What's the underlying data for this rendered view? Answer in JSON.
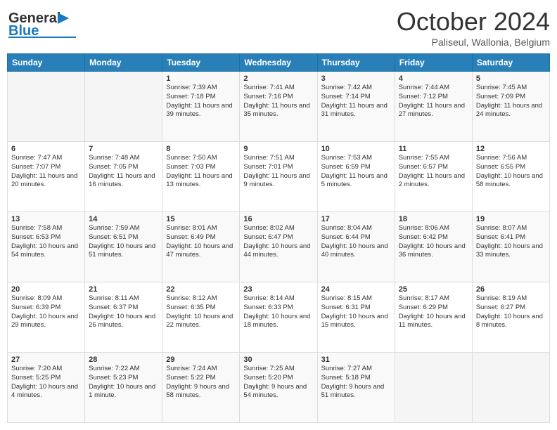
{
  "header": {
    "logo_line1": "General",
    "logo_line2": "Blue",
    "month": "October 2024",
    "location": "Paliseul, Wallonia, Belgium"
  },
  "days_of_week": [
    "Sunday",
    "Monday",
    "Tuesday",
    "Wednesday",
    "Thursday",
    "Friday",
    "Saturday"
  ],
  "weeks": [
    [
      {
        "day": "",
        "sunrise": "",
        "sunset": "",
        "daylight": ""
      },
      {
        "day": "",
        "sunrise": "",
        "sunset": "",
        "daylight": ""
      },
      {
        "day": "1",
        "sunrise": "Sunrise: 7:39 AM",
        "sunset": "Sunset: 7:18 PM",
        "daylight": "Daylight: 11 hours and 39 minutes."
      },
      {
        "day": "2",
        "sunrise": "Sunrise: 7:41 AM",
        "sunset": "Sunset: 7:16 PM",
        "daylight": "Daylight: 11 hours and 35 minutes."
      },
      {
        "day": "3",
        "sunrise": "Sunrise: 7:42 AM",
        "sunset": "Sunset: 7:14 PM",
        "daylight": "Daylight: 11 hours and 31 minutes."
      },
      {
        "day": "4",
        "sunrise": "Sunrise: 7:44 AM",
        "sunset": "Sunset: 7:12 PM",
        "daylight": "Daylight: 11 hours and 27 minutes."
      },
      {
        "day": "5",
        "sunrise": "Sunrise: 7:45 AM",
        "sunset": "Sunset: 7:09 PM",
        "daylight": "Daylight: 11 hours and 24 minutes."
      }
    ],
    [
      {
        "day": "6",
        "sunrise": "Sunrise: 7:47 AM",
        "sunset": "Sunset: 7:07 PM",
        "daylight": "Daylight: 11 hours and 20 minutes."
      },
      {
        "day": "7",
        "sunrise": "Sunrise: 7:48 AM",
        "sunset": "Sunset: 7:05 PM",
        "daylight": "Daylight: 11 hours and 16 minutes."
      },
      {
        "day": "8",
        "sunrise": "Sunrise: 7:50 AM",
        "sunset": "Sunset: 7:03 PM",
        "daylight": "Daylight: 11 hours and 13 minutes."
      },
      {
        "day": "9",
        "sunrise": "Sunrise: 7:51 AM",
        "sunset": "Sunset: 7:01 PM",
        "daylight": "Daylight: 11 hours and 9 minutes."
      },
      {
        "day": "10",
        "sunrise": "Sunrise: 7:53 AM",
        "sunset": "Sunset: 6:59 PM",
        "daylight": "Daylight: 11 hours and 5 minutes."
      },
      {
        "day": "11",
        "sunrise": "Sunrise: 7:55 AM",
        "sunset": "Sunset: 6:57 PM",
        "daylight": "Daylight: 11 hours and 2 minutes."
      },
      {
        "day": "12",
        "sunrise": "Sunrise: 7:56 AM",
        "sunset": "Sunset: 6:55 PM",
        "daylight": "Daylight: 10 hours and 58 minutes."
      }
    ],
    [
      {
        "day": "13",
        "sunrise": "Sunrise: 7:58 AM",
        "sunset": "Sunset: 6:53 PM",
        "daylight": "Daylight: 10 hours and 54 minutes."
      },
      {
        "day": "14",
        "sunrise": "Sunrise: 7:59 AM",
        "sunset": "Sunset: 6:51 PM",
        "daylight": "Daylight: 10 hours and 51 minutes."
      },
      {
        "day": "15",
        "sunrise": "Sunrise: 8:01 AM",
        "sunset": "Sunset: 6:49 PM",
        "daylight": "Daylight: 10 hours and 47 minutes."
      },
      {
        "day": "16",
        "sunrise": "Sunrise: 8:02 AM",
        "sunset": "Sunset: 6:47 PM",
        "daylight": "Daylight: 10 hours and 44 minutes."
      },
      {
        "day": "17",
        "sunrise": "Sunrise: 8:04 AM",
        "sunset": "Sunset: 6:44 PM",
        "daylight": "Daylight: 10 hours and 40 minutes."
      },
      {
        "day": "18",
        "sunrise": "Sunrise: 8:06 AM",
        "sunset": "Sunset: 6:42 PM",
        "daylight": "Daylight: 10 hours and 36 minutes."
      },
      {
        "day": "19",
        "sunrise": "Sunrise: 8:07 AM",
        "sunset": "Sunset: 6:41 PM",
        "daylight": "Daylight: 10 hours and 33 minutes."
      }
    ],
    [
      {
        "day": "20",
        "sunrise": "Sunrise: 8:09 AM",
        "sunset": "Sunset: 6:39 PM",
        "daylight": "Daylight: 10 hours and 29 minutes."
      },
      {
        "day": "21",
        "sunrise": "Sunrise: 8:11 AM",
        "sunset": "Sunset: 6:37 PM",
        "daylight": "Daylight: 10 hours and 26 minutes."
      },
      {
        "day": "22",
        "sunrise": "Sunrise: 8:12 AM",
        "sunset": "Sunset: 6:35 PM",
        "daylight": "Daylight: 10 hours and 22 minutes."
      },
      {
        "day": "23",
        "sunrise": "Sunrise: 8:14 AM",
        "sunset": "Sunset: 6:33 PM",
        "daylight": "Daylight: 10 hours and 18 minutes."
      },
      {
        "day": "24",
        "sunrise": "Sunrise: 8:15 AM",
        "sunset": "Sunset: 6:31 PM",
        "daylight": "Daylight: 10 hours and 15 minutes."
      },
      {
        "day": "25",
        "sunrise": "Sunrise: 8:17 AM",
        "sunset": "Sunset: 6:29 PM",
        "daylight": "Daylight: 10 hours and 11 minutes."
      },
      {
        "day": "26",
        "sunrise": "Sunrise: 8:19 AM",
        "sunset": "Sunset: 6:27 PM",
        "daylight": "Daylight: 10 hours and 8 minutes."
      }
    ],
    [
      {
        "day": "27",
        "sunrise": "Sunrise: 7:20 AM",
        "sunset": "Sunset: 5:25 PM",
        "daylight": "Daylight: 10 hours and 4 minutes."
      },
      {
        "day": "28",
        "sunrise": "Sunrise: 7:22 AM",
        "sunset": "Sunset: 5:23 PM",
        "daylight": "Daylight: 10 hours and 1 minute."
      },
      {
        "day": "29",
        "sunrise": "Sunrise: 7:24 AM",
        "sunset": "Sunset: 5:22 PM",
        "daylight": "Daylight: 9 hours and 58 minutes."
      },
      {
        "day": "30",
        "sunrise": "Sunrise: 7:25 AM",
        "sunset": "Sunset: 5:20 PM",
        "daylight": "Daylight: 9 hours and 54 minutes."
      },
      {
        "day": "31",
        "sunrise": "Sunrise: 7:27 AM",
        "sunset": "Sunset: 5:18 PM",
        "daylight": "Daylight: 9 hours and 51 minutes."
      },
      {
        "day": "",
        "sunrise": "",
        "sunset": "",
        "daylight": ""
      },
      {
        "day": "",
        "sunrise": "",
        "sunset": "",
        "daylight": ""
      }
    ]
  ]
}
